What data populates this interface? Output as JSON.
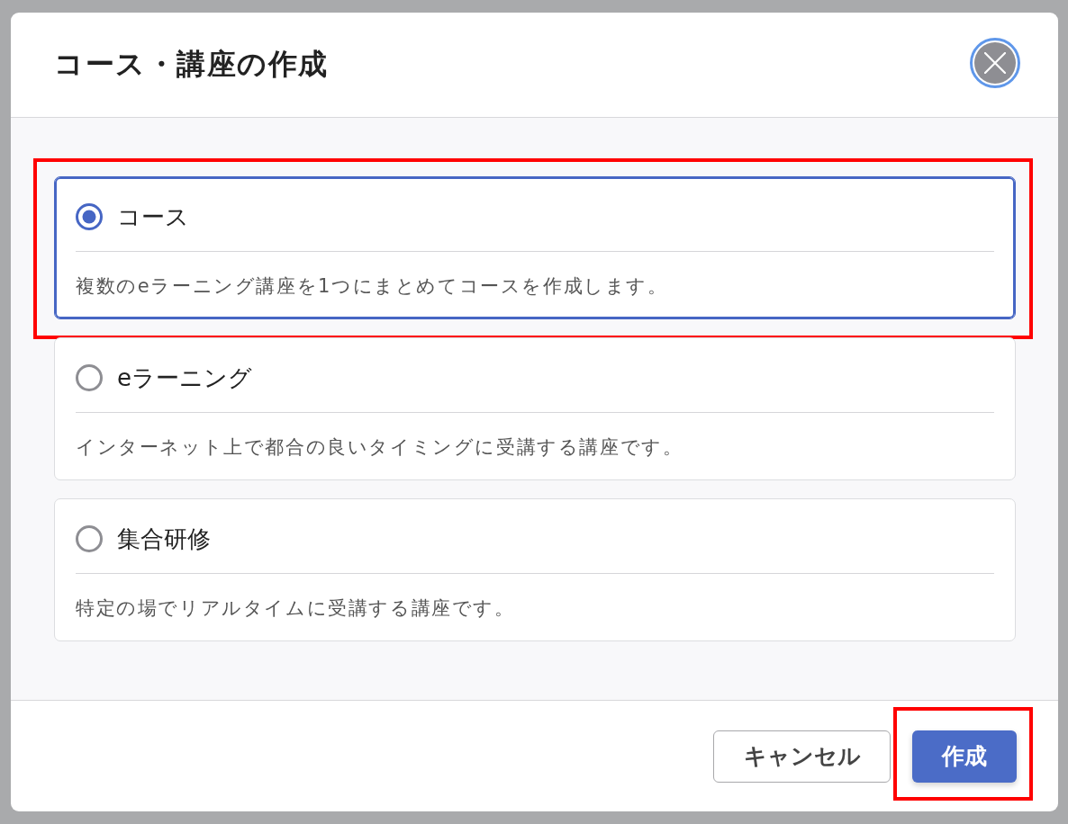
{
  "dialog": {
    "title": "コース・講座の作成",
    "close_button": {
      "focused": true
    }
  },
  "options": [
    {
      "label": "コース",
      "description": "複数のeラーニング講座を1つにまとめてコースを作成します。",
      "selected": true,
      "highlighted": true
    },
    {
      "label": "eラーニング",
      "description": "インターネット上で都合の良いタイミングに受講する講座です。",
      "selected": false,
      "highlighted": false
    },
    {
      "label": "集合研修",
      "description": "特定の場でリアルタイムに受講する講座です。",
      "selected": false,
      "highlighted": false
    }
  ],
  "buttons": [
    {
      "kind": "secondary",
      "label": "キャンセル",
      "highlighted": false
    },
    {
      "kind": "primary",
      "label": "作成",
      "highlighted": true
    }
  ]
}
